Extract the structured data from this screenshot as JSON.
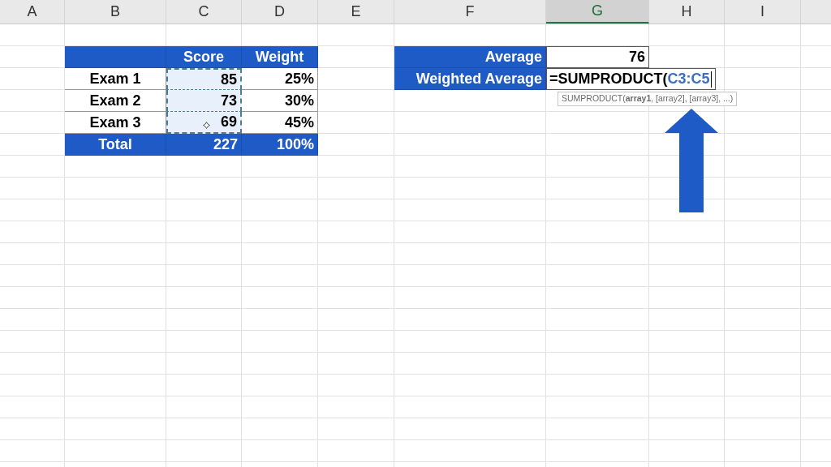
{
  "columns": [
    {
      "label": "A",
      "selected": false
    },
    {
      "label": "B",
      "selected": false
    },
    {
      "label": "C",
      "selected": false
    },
    {
      "label": "D",
      "selected": false
    },
    {
      "label": "E",
      "selected": false
    },
    {
      "label": "F",
      "selected": false
    },
    {
      "label": "G",
      "selected": true
    },
    {
      "label": "H",
      "selected": false
    },
    {
      "label": "I",
      "selected": false
    }
  ],
  "score_table": {
    "headers": [
      "Score",
      "Weight"
    ],
    "rows": [
      {
        "label": "Exam 1",
        "score": "85",
        "weight": "25%",
        "marked": true
      },
      {
        "label": "Exam 2",
        "score": "73",
        "weight": "30%",
        "marked": true
      },
      {
        "label": "Exam 3",
        "score": "69",
        "weight": "45%",
        "marked": true
      }
    ],
    "total": {
      "label": "Total",
      "score": "227",
      "weight": "100%"
    }
  },
  "summary": [
    {
      "kind": "value",
      "label": "Average",
      "value": "76"
    },
    {
      "kind": "editing",
      "label": "Weighted Average",
      "formula": "=SUMPRODUCT(",
      "reference": "C3:C5"
    }
  ],
  "tooltip": "SUMPRODUCT(**array1**, [array2], [array3], ...)"
}
